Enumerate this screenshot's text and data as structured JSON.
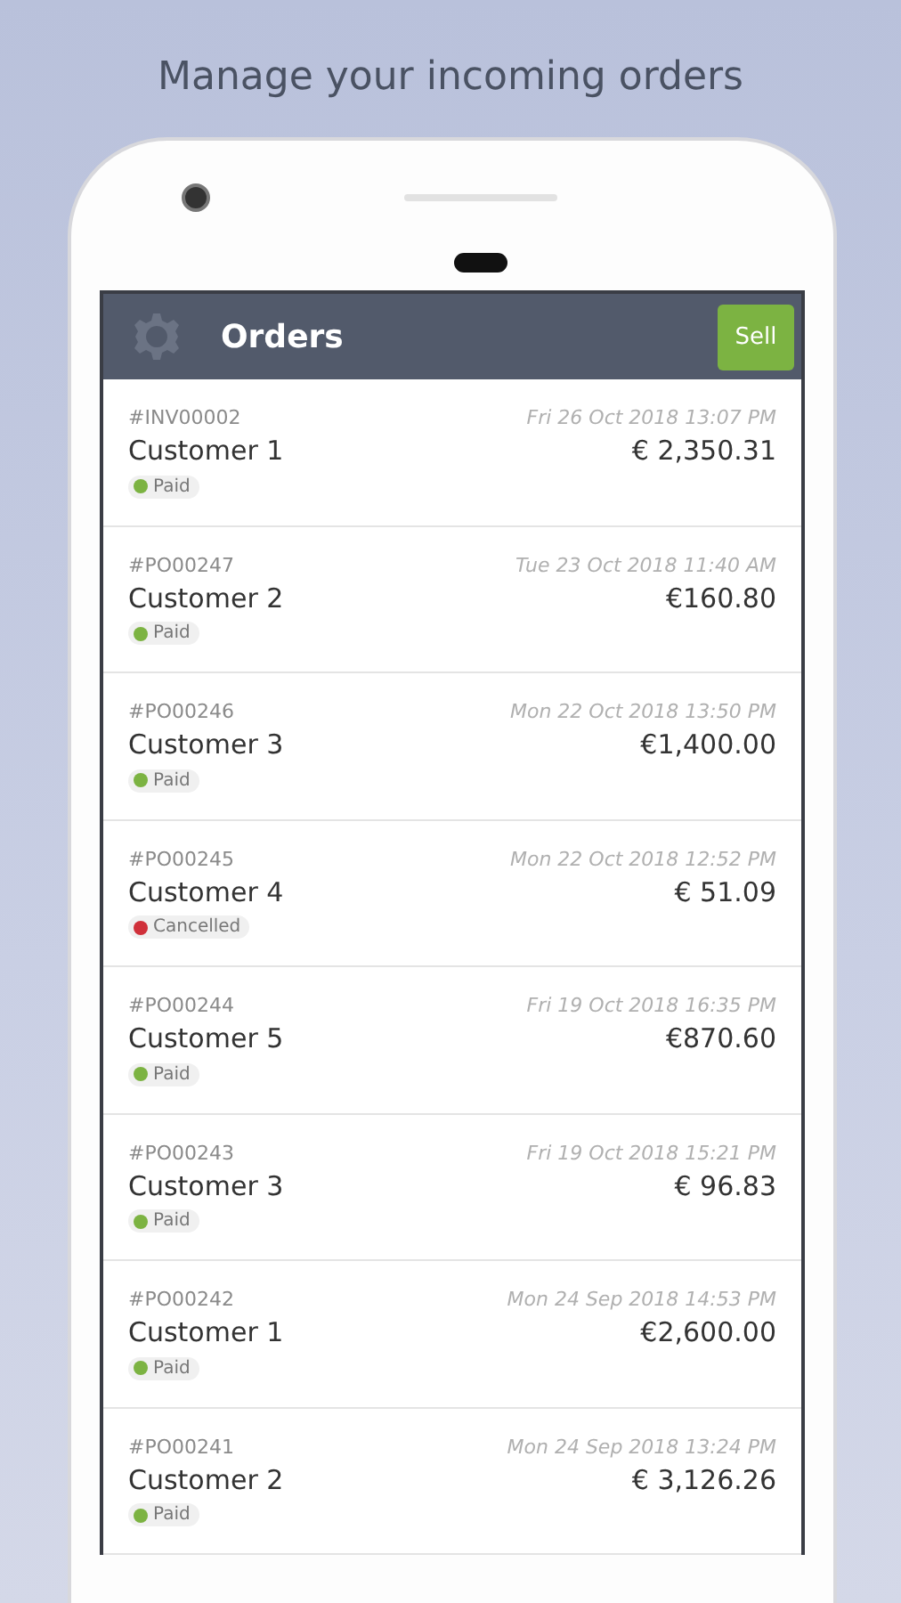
{
  "headline": "Manage your incoming orders",
  "app_bar": {
    "title": "Orders",
    "action": "Sell"
  },
  "orders": [
    {
      "number": "#INV00002",
      "date": "Fri 26 Oct 2018 13:07 PM",
      "customer": "Customer 1",
      "amount": "€ 2,350.31",
      "status": "Paid",
      "color": "#7cb342"
    },
    {
      "number": "#PO00247",
      "date": "Tue 23 Oct 2018 11:40 AM",
      "customer": "Customer 2",
      "amount": "€160.80",
      "status": "Paid",
      "color": "#7cb342"
    },
    {
      "number": "#PO00246",
      "date": "Mon 22 Oct 2018 13:50 PM",
      "customer": "Customer 3",
      "amount": "€1,400.00",
      "status": "Paid",
      "color": "#7cb342"
    },
    {
      "number": "#PO00245",
      "date": "Mon 22 Oct 2018 12:52 PM",
      "customer": "Customer 4",
      "amount": "€ 51.09",
      "status": "Cancelled",
      "color": "#d0303a"
    },
    {
      "number": "#PO00244",
      "date": "Fri 19 Oct 2018 16:35 PM",
      "customer": "Customer 5",
      "amount": "€870.60",
      "status": "Paid",
      "color": "#7cb342"
    },
    {
      "number": "#PO00243",
      "date": "Fri 19 Oct 2018 15:21 PM",
      "customer": "Customer 3",
      "amount": "€ 96.83",
      "status": "Paid",
      "color": "#7cb342"
    },
    {
      "number": "#PO00242",
      "date": "Mon 24 Sep 2018 14:53 PM",
      "customer": "Customer 1",
      "amount": "€2,600.00",
      "status": "Paid",
      "color": "#7cb342"
    },
    {
      "number": "#PO00241",
      "date": "Mon 24 Sep 2018 13:24 PM",
      "customer": "Customer 2",
      "amount": "€ 3,126.26",
      "status": "Paid",
      "color": "#7cb342"
    }
  ]
}
